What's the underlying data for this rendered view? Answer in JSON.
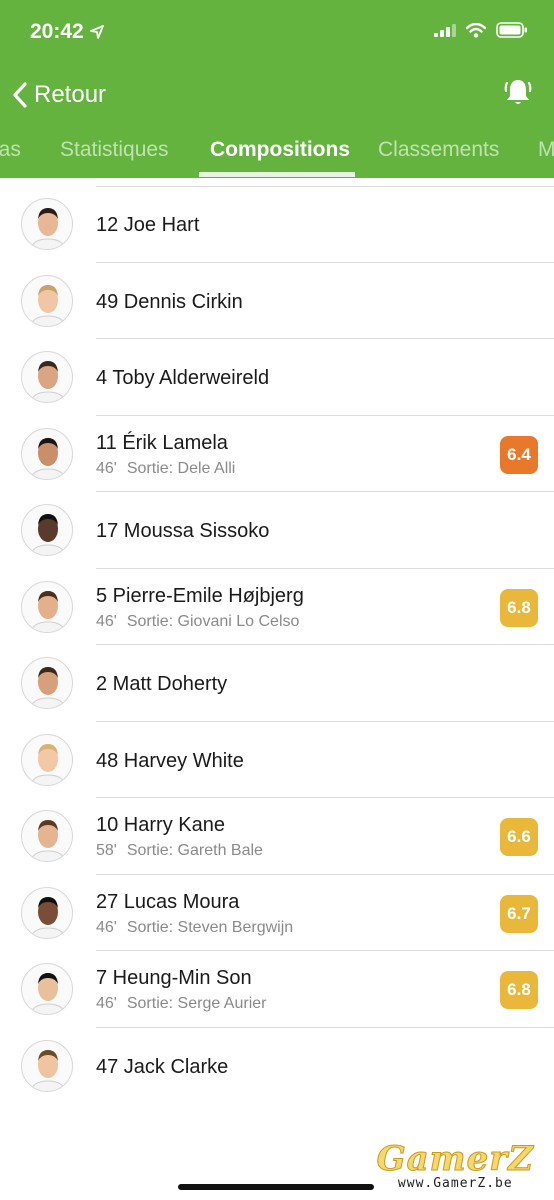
{
  "status": {
    "time": "20:42"
  },
  "nav": {
    "back_label": "Retour"
  },
  "tabs": [
    {
      "label": "ias",
      "active": false
    },
    {
      "label": "Statistiques",
      "active": false
    },
    {
      "label": "Compositions",
      "active": true
    },
    {
      "label": "Classements",
      "active": false
    },
    {
      "label": "M",
      "active": false
    }
  ],
  "players": [
    {
      "name": "12 Joe Hart"
    },
    {
      "name": "49 Dennis Cirkin"
    },
    {
      "name": "4 Toby Alderweireld"
    },
    {
      "name": "11 Érik Lamela",
      "minute": "46'",
      "sub": "Sortie: Dele Alli",
      "rating": "6.4",
      "rating_color": "#e8792b"
    },
    {
      "name": "17 Moussa Sissoko"
    },
    {
      "name": "5 Pierre-Emile Højbjerg",
      "minute": "46'",
      "sub": "Sortie: Giovani Lo Celso",
      "rating": "6.8",
      "rating_color": "#e9b83a"
    },
    {
      "name": "2 Matt Doherty"
    },
    {
      "name": "48 Harvey White"
    },
    {
      "name": "10 Harry Kane",
      "minute": "58'",
      "sub": "Sortie: Gareth Bale",
      "rating": "6.6",
      "rating_color": "#e9b83a"
    },
    {
      "name": "27 Lucas Moura",
      "minute": "46'",
      "sub": "Sortie: Steven Bergwijn",
      "rating": "6.7",
      "rating_color": "#e9b83a"
    },
    {
      "name": "7 Heung-Min Son",
      "minute": "46'",
      "sub": "Sortie: Serge Aurier",
      "rating": "6.8",
      "rating_color": "#e9b83a"
    },
    {
      "name": "47 Jack Clarke"
    }
  ],
  "watermark": {
    "logo": "GamerZ",
    "url": "www.GamerZ.be"
  },
  "colors": {
    "header": "#64b33e"
  }
}
